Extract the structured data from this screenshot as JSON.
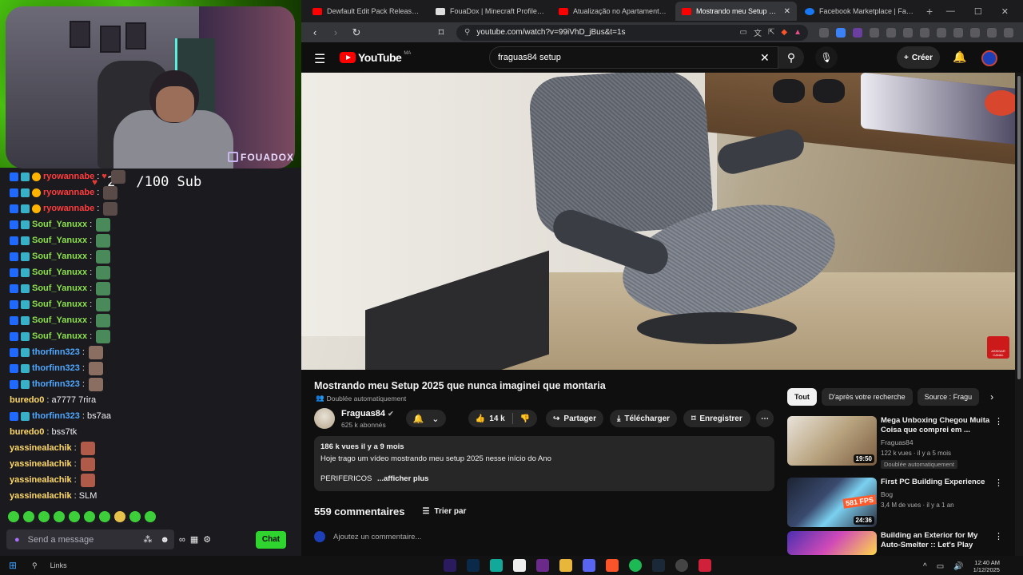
{
  "overlay": {
    "watermark": "FOUADOX",
    "sub_goal": {
      "current": "2",
      "total": "/100 Sub"
    }
  },
  "chat": {
    "messages": [
      {
        "user": "ryowannabe",
        "text": "",
        "color": "red"
      },
      {
        "user": "ryowannabe",
        "text": "",
        "color": "red"
      },
      {
        "user": "ryowannabe",
        "text": "",
        "color": "red"
      },
      {
        "user": "Souf_Yanuxx",
        "text": "",
        "color": "green"
      },
      {
        "user": "Souf_Yanuxx",
        "text": "",
        "color": "green"
      },
      {
        "user": "Souf_Yanuxx",
        "text": "",
        "color": "green"
      },
      {
        "user": "Souf_Yanuxx",
        "text": "",
        "color": "green"
      },
      {
        "user": "Souf_Yanuxx",
        "text": "",
        "color": "green"
      },
      {
        "user": "Souf_Yanuxx",
        "text": "",
        "color": "green"
      },
      {
        "user": "Souf_Yanuxx",
        "text": "",
        "color": "green"
      },
      {
        "user": "Souf_Yanuxx",
        "text": "",
        "color": "green"
      },
      {
        "user": "thorfinn323",
        "text": "",
        "color": "blue"
      },
      {
        "user": "thorfinn323",
        "text": "",
        "color": "blue"
      },
      {
        "user": "thorfinn323",
        "text": "",
        "color": "blue"
      },
      {
        "user": "buredo0",
        "text": "a7777 7rira",
        "color": "yellow"
      },
      {
        "user": "thorfinn323",
        "text": "bs7aa",
        "color": "blue"
      },
      {
        "user": "buredo0",
        "text": "bss7tk",
        "color": "yellow"
      },
      {
        "user": "yassinealachik",
        "text": "",
        "color": "yellow"
      },
      {
        "user": "yassinealachik",
        "text": "",
        "color": "yellow"
      },
      {
        "user": "yassinealachik",
        "text": "",
        "color": "yellow"
      },
      {
        "user": "yassinealachik",
        "text": "SLM",
        "color": "yellow"
      }
    ],
    "input_placeholder": "Send a message",
    "chat_button": "Chat"
  },
  "browser": {
    "tabs": [
      {
        "title": "Dewfault Edit Pack Release | Dew",
        "active": false
      },
      {
        "title": "FouaDox | Minecraft Profile | Nam",
        "active": false
      },
      {
        "title": "Atualização no Apartamento Gan",
        "active": false
      },
      {
        "title": "Mostrando meu Setup 2025",
        "active": true
      },
      {
        "title": "Facebook Marketplace | Facebook",
        "active": false
      }
    ],
    "url": "youtube.com/watch?v=99iVhD_jBus&t=1s"
  },
  "youtube": {
    "logo": "YouTube",
    "country_code": "MA",
    "search_query": "fraguas84 setup",
    "create_label": "Créer",
    "video": {
      "title": "Mostrando meu Setup 2025 que nunca imaginei que montaria",
      "dub_label": "Doublée automatiquement",
      "subscribe_watermark": "ASSINAR CANAL",
      "channel": "Fraguas84",
      "subscribers": "625 k abonnés",
      "likes": "14 k",
      "share": "Partager",
      "download": "Télécharger",
      "save": "Enregistrer",
      "views_date": "186 k vues  il y a 9 mois",
      "description": "Hoje trago um vídeo mostrando meu setup 2025 nesse início do Ano",
      "desc_first_word": "PERIFERICOS",
      "show_more": "...afficher plus"
    },
    "comments": {
      "count": "559 commentaires",
      "sort": "Trier par",
      "add_placeholder": "Ajoutez un commentaire..."
    },
    "chips": [
      "Tout",
      "D'après votre recherche",
      "Source : Fragu"
    ],
    "recommendations": [
      {
        "title": "Mega Unboxing Chegou Muita Coisa que comprei em ...",
        "channel": "Fraguas84",
        "meta": "122 k vues · il y a 5 mois",
        "duration": "19:50",
        "badge": "Doublée automatiquement"
      },
      {
        "title": "First PC Building Experience",
        "channel": "Bog",
        "meta": "3,4 M de vues · il y a 1 an",
        "duration": "24:36",
        "thumb_text": "581 FPS"
      },
      {
        "title": "Building an Exterior for My Auto-Smelter :: Let's Play",
        "channel": "",
        "meta": "",
        "duration": ""
      }
    ]
  },
  "taskbar": {
    "search_label": "Links",
    "time": "12:40 AM",
    "date": "1/12/2025"
  },
  "colors": {
    "twitch_green": "#2fd42f",
    "yt_red": "#ff0000",
    "bg": "#0f0f0f"
  }
}
